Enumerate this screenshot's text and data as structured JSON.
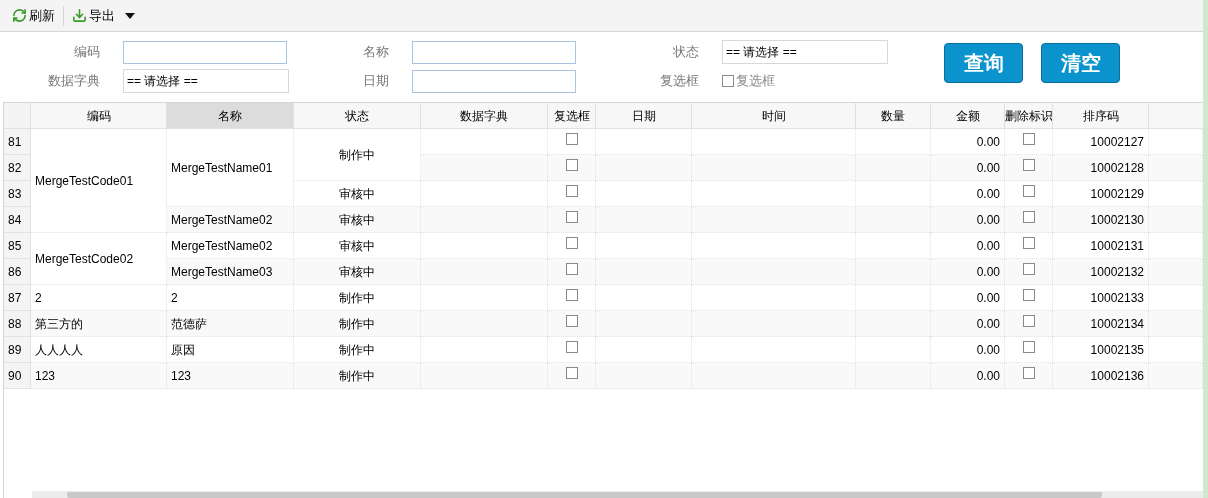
{
  "toolbar": {
    "buttons": [
      {
        "label": "刷新",
        "kind": "refresh"
      },
      {
        "label": "导出",
        "kind": "export",
        "dropdown": true
      }
    ]
  },
  "filters": [
    {
      "label": "编码",
      "kind": "text"
    },
    {
      "label": "名称",
      "kind": "text"
    },
    {
      "label": "状态",
      "kind": "select",
      "value": "== 请选择 =="
    },
    {
      "label": "数据字典",
      "kind": "select",
      "value": "== 请选择 =="
    },
    {
      "label": "日期",
      "kind": "text"
    },
    {
      "label": "复选框",
      "kind": "checkbox",
      "text": "复选框",
      "checked": false
    }
  ],
  "buttons": [
    "查询",
    "清空"
  ],
  "table": {
    "columns": [
      {
        "label": "编码",
        "selected": false
      },
      {
        "label": "名称",
        "selected": true
      },
      {
        "label": "状态",
        "selected": false
      },
      {
        "label": "数据字典",
        "selected": false
      },
      {
        "label": "复选框",
        "selected": false
      },
      {
        "label": "日期",
        "selected": false
      },
      {
        "label": "时间",
        "selected": false
      },
      {
        "label": "数量",
        "selected": false
      },
      {
        "label": "金额",
        "selected": false
      },
      {
        "label": "删除标识",
        "selected": false
      },
      {
        "label": "排序码",
        "selected": false
      }
    ],
    "rows": [
      {
        "number": "81",
        "code": "MergeTestCode01",
        "name": "MergeTestName01",
        "status": "制作中",
        "checked": false,
        "amount": "0.00",
        "delete_checked": false,
        "sort_code": "10002127"
      },
      {
        "number": "82",
        "code_merged": true,
        "name_merged": true,
        "status_merged": true,
        "checked": false,
        "amount": "0.00",
        "delete_checked": false,
        "sort_code": "10002128"
      },
      {
        "number": "83",
        "code_merged": true,
        "name_merged": true,
        "status": "审核中",
        "checked": false,
        "amount": "0.00",
        "delete_checked": false,
        "sort_code": "10002129"
      },
      {
        "number": "84",
        "code_merged": true,
        "name": "MergeTestName02",
        "status": "审核中",
        "checked": false,
        "amount": "0.00",
        "delete_checked": false,
        "sort_code": "10002130"
      },
      {
        "number": "85",
        "code": "MergeTestCode02",
        "name": "MergeTestName02",
        "status": "审核中",
        "checked": false,
        "amount": "0.00",
        "delete_checked": false,
        "sort_code": "10002131"
      },
      {
        "number": "86",
        "code_merged": true,
        "name": "MergeTestName03",
        "status": "审核中",
        "checked": false,
        "amount": "0.00",
        "delete_checked": false,
        "sort_code": "10002132"
      },
      {
        "number": "87",
        "code": "2",
        "name": "2",
        "status": "制作中",
        "checked": false,
        "amount": "0.00",
        "delete_checked": false,
        "sort_code": "10002133"
      },
      {
        "number": "88",
        "code": "第三方的",
        "name": "范德萨",
        "status": "制作中",
        "checked": false,
        "amount": "0.00",
        "delete_checked": false,
        "sort_code": "10002134"
      },
      {
        "number": "89",
        "code": "人人人人",
        "name": "原因",
        "status": "制作中",
        "checked": false,
        "amount": "0.00",
        "delete_checked": false,
        "sort_code": "10002135"
      },
      {
        "number": "90",
        "code": "123",
        "name": "123",
        "status": "制作中",
        "checked": false,
        "amount": "0.00",
        "delete_checked": false,
        "sort_code": "10002136"
      }
    ]
  }
}
